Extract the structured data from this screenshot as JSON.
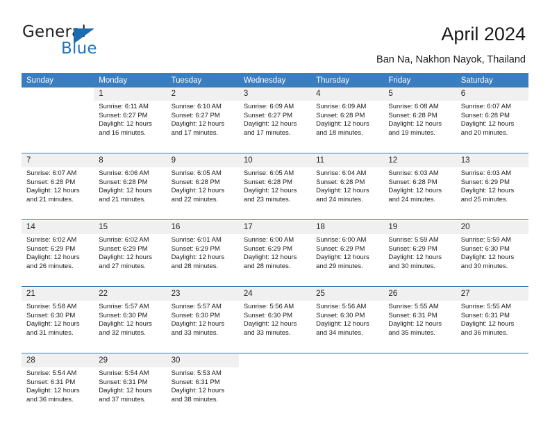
{
  "brand": {
    "word_one": "General",
    "word_two": "Blue",
    "triangle_icon": "blue-triangle-logo-mark",
    "accent_color": "#1b6cb0"
  },
  "header": {
    "title": "April 2024",
    "subtitle": "Ban Na, Nakhon Nayok, Thailand"
  },
  "calendar": {
    "header_bg": "#3a7ebf",
    "daynum_bg": "#f0f0f0",
    "week_separator_color": "#2e6da4",
    "weekdays": [
      "Sunday",
      "Monday",
      "Tuesday",
      "Wednesday",
      "Thursday",
      "Friday",
      "Saturday"
    ],
    "weeks": [
      [
        {
          "day": "",
          "sunrise": "",
          "sunset": "",
          "daylight_1": "",
          "daylight_2": ""
        },
        {
          "day": "1",
          "sunrise": "Sunrise: 6:11 AM",
          "sunset": "Sunset: 6:27 PM",
          "daylight_1": "Daylight: 12 hours",
          "daylight_2": "and 16 minutes."
        },
        {
          "day": "2",
          "sunrise": "Sunrise: 6:10 AM",
          "sunset": "Sunset: 6:27 PM",
          "daylight_1": "Daylight: 12 hours",
          "daylight_2": "and 17 minutes."
        },
        {
          "day": "3",
          "sunrise": "Sunrise: 6:09 AM",
          "sunset": "Sunset: 6:27 PM",
          "daylight_1": "Daylight: 12 hours",
          "daylight_2": "and 17 minutes."
        },
        {
          "day": "4",
          "sunrise": "Sunrise: 6:09 AM",
          "sunset": "Sunset: 6:28 PM",
          "daylight_1": "Daylight: 12 hours",
          "daylight_2": "and 18 minutes."
        },
        {
          "day": "5",
          "sunrise": "Sunrise: 6:08 AM",
          "sunset": "Sunset: 6:28 PM",
          "daylight_1": "Daylight: 12 hours",
          "daylight_2": "and 19 minutes."
        },
        {
          "day": "6",
          "sunrise": "Sunrise: 6:07 AM",
          "sunset": "Sunset: 6:28 PM",
          "daylight_1": "Daylight: 12 hours",
          "daylight_2": "and 20 minutes."
        }
      ],
      [
        {
          "day": "7",
          "sunrise": "Sunrise: 6:07 AM",
          "sunset": "Sunset: 6:28 PM",
          "daylight_1": "Daylight: 12 hours",
          "daylight_2": "and 21 minutes."
        },
        {
          "day": "8",
          "sunrise": "Sunrise: 6:06 AM",
          "sunset": "Sunset: 6:28 PM",
          "daylight_1": "Daylight: 12 hours",
          "daylight_2": "and 21 minutes."
        },
        {
          "day": "9",
          "sunrise": "Sunrise: 6:05 AM",
          "sunset": "Sunset: 6:28 PM",
          "daylight_1": "Daylight: 12 hours",
          "daylight_2": "and 22 minutes."
        },
        {
          "day": "10",
          "sunrise": "Sunrise: 6:05 AM",
          "sunset": "Sunset: 6:28 PM",
          "daylight_1": "Daylight: 12 hours",
          "daylight_2": "and 23 minutes."
        },
        {
          "day": "11",
          "sunrise": "Sunrise: 6:04 AM",
          "sunset": "Sunset: 6:28 PM",
          "daylight_1": "Daylight: 12 hours",
          "daylight_2": "and 24 minutes."
        },
        {
          "day": "12",
          "sunrise": "Sunrise: 6:03 AM",
          "sunset": "Sunset: 6:28 PM",
          "daylight_1": "Daylight: 12 hours",
          "daylight_2": "and 24 minutes."
        },
        {
          "day": "13",
          "sunrise": "Sunrise: 6:03 AM",
          "sunset": "Sunset: 6:29 PM",
          "daylight_1": "Daylight: 12 hours",
          "daylight_2": "and 25 minutes."
        }
      ],
      [
        {
          "day": "14",
          "sunrise": "Sunrise: 6:02 AM",
          "sunset": "Sunset: 6:29 PM",
          "daylight_1": "Daylight: 12 hours",
          "daylight_2": "and 26 minutes."
        },
        {
          "day": "15",
          "sunrise": "Sunrise: 6:02 AM",
          "sunset": "Sunset: 6:29 PM",
          "daylight_1": "Daylight: 12 hours",
          "daylight_2": "and 27 minutes."
        },
        {
          "day": "16",
          "sunrise": "Sunrise: 6:01 AM",
          "sunset": "Sunset: 6:29 PM",
          "daylight_1": "Daylight: 12 hours",
          "daylight_2": "and 28 minutes."
        },
        {
          "day": "17",
          "sunrise": "Sunrise: 6:00 AM",
          "sunset": "Sunset: 6:29 PM",
          "daylight_1": "Daylight: 12 hours",
          "daylight_2": "and 28 minutes."
        },
        {
          "day": "18",
          "sunrise": "Sunrise: 6:00 AM",
          "sunset": "Sunset: 6:29 PM",
          "daylight_1": "Daylight: 12 hours",
          "daylight_2": "and 29 minutes."
        },
        {
          "day": "19",
          "sunrise": "Sunrise: 5:59 AM",
          "sunset": "Sunset: 6:29 PM",
          "daylight_1": "Daylight: 12 hours",
          "daylight_2": "and 30 minutes."
        },
        {
          "day": "20",
          "sunrise": "Sunrise: 5:59 AM",
          "sunset": "Sunset: 6:30 PM",
          "daylight_1": "Daylight: 12 hours",
          "daylight_2": "and 30 minutes."
        }
      ],
      [
        {
          "day": "21",
          "sunrise": "Sunrise: 5:58 AM",
          "sunset": "Sunset: 6:30 PM",
          "daylight_1": "Daylight: 12 hours",
          "daylight_2": "and 31 minutes."
        },
        {
          "day": "22",
          "sunrise": "Sunrise: 5:57 AM",
          "sunset": "Sunset: 6:30 PM",
          "daylight_1": "Daylight: 12 hours",
          "daylight_2": "and 32 minutes."
        },
        {
          "day": "23",
          "sunrise": "Sunrise: 5:57 AM",
          "sunset": "Sunset: 6:30 PM",
          "daylight_1": "Daylight: 12 hours",
          "daylight_2": "and 33 minutes."
        },
        {
          "day": "24",
          "sunrise": "Sunrise: 5:56 AM",
          "sunset": "Sunset: 6:30 PM",
          "daylight_1": "Daylight: 12 hours",
          "daylight_2": "and 33 minutes."
        },
        {
          "day": "25",
          "sunrise": "Sunrise: 5:56 AM",
          "sunset": "Sunset: 6:30 PM",
          "daylight_1": "Daylight: 12 hours",
          "daylight_2": "and 34 minutes."
        },
        {
          "day": "26",
          "sunrise": "Sunrise: 5:55 AM",
          "sunset": "Sunset: 6:31 PM",
          "daylight_1": "Daylight: 12 hours",
          "daylight_2": "and 35 minutes."
        },
        {
          "day": "27",
          "sunrise": "Sunrise: 5:55 AM",
          "sunset": "Sunset: 6:31 PM",
          "daylight_1": "Daylight: 12 hours",
          "daylight_2": "and 36 minutes."
        }
      ],
      [
        {
          "day": "28",
          "sunrise": "Sunrise: 5:54 AM",
          "sunset": "Sunset: 6:31 PM",
          "daylight_1": "Daylight: 12 hours",
          "daylight_2": "and 36 minutes."
        },
        {
          "day": "29",
          "sunrise": "Sunrise: 5:54 AM",
          "sunset": "Sunset: 6:31 PM",
          "daylight_1": "Daylight: 12 hours",
          "daylight_2": "and 37 minutes."
        },
        {
          "day": "30",
          "sunrise": "Sunrise: 5:53 AM",
          "sunset": "Sunset: 6:31 PM",
          "daylight_1": "Daylight: 12 hours",
          "daylight_2": "and 38 minutes."
        },
        {
          "day": "",
          "sunrise": "",
          "sunset": "",
          "daylight_1": "",
          "daylight_2": ""
        },
        {
          "day": "",
          "sunrise": "",
          "sunset": "",
          "daylight_1": "",
          "daylight_2": ""
        },
        {
          "day": "",
          "sunrise": "",
          "sunset": "",
          "daylight_1": "",
          "daylight_2": ""
        },
        {
          "day": "",
          "sunrise": "",
          "sunset": "",
          "daylight_1": "",
          "daylight_2": ""
        }
      ]
    ]
  }
}
